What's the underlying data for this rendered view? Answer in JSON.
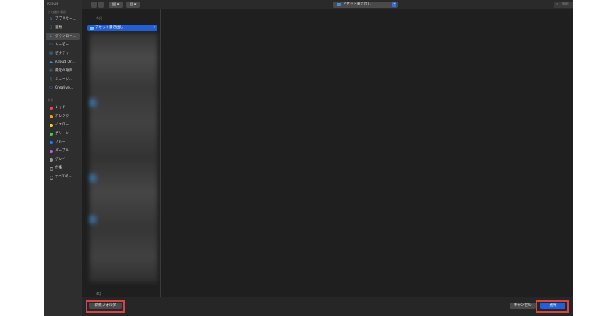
{
  "sidebar": {
    "top_label": "iCloud",
    "favorites_heading": "よく使う項目",
    "items": [
      {
        "label": "アプリケー...",
        "icon": "applications-icon"
      },
      {
        "label": "書類",
        "icon": "document-icon"
      },
      {
        "label": "ダウンロー...",
        "icon": "download-icon",
        "selected": true
      },
      {
        "label": "ムービー",
        "icon": "movie-icon"
      },
      {
        "label": "ピクチャ",
        "icon": "picture-icon"
      },
      {
        "label": "iCloud Dri...",
        "icon": "cloud-icon"
      },
      {
        "label": "最近の項目",
        "icon": "clock-icon"
      },
      {
        "label": "ミュージ...",
        "icon": "music-icon"
      },
      {
        "label": "Creative...",
        "icon": "folder-icon"
      }
    ],
    "tags_heading": "タグ",
    "tags": [
      {
        "label": "レッド",
        "color": "#ff453a"
      },
      {
        "label": "オレンジ",
        "color": "#ff9f0a"
      },
      {
        "label": "イエロー",
        "color": "#ffd60a"
      },
      {
        "label": "グリーン",
        "color": "#32d74b"
      },
      {
        "label": "ブルー",
        "color": "#0a84ff"
      },
      {
        "label": "パープル",
        "color": "#bf5af2"
      },
      {
        "label": "グレイ",
        "color": "#98989d"
      },
      {
        "label": "仕事",
        "color": "hollow"
      },
      {
        "label": "すべての...",
        "color": "hollow"
      }
    ]
  },
  "toolbar": {
    "back_icon": "‹",
    "forward_icon": "›",
    "view_icon": "▥ ▾",
    "group_icon": "▤ ▾",
    "path_label": "アセット書き出し",
    "path_arrows": "⌃",
    "search_icon": "⌕",
    "search_placeholder": "検索"
  },
  "browser": {
    "section_top": "今日",
    "selected_folder": "アセット書き出し",
    "section_bottom": "4月"
  },
  "footer": {
    "new_folder": "新規フォルダ",
    "cancel": "キャンセル",
    "choose": "選択"
  },
  "colors": {
    "accent": "#2160d8",
    "highlight": "#d64545"
  }
}
